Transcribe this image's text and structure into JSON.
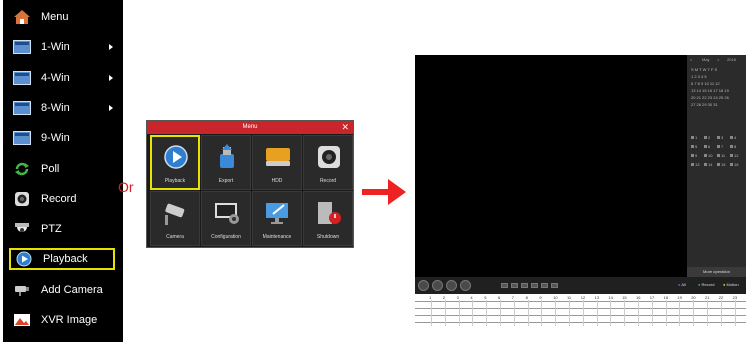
{
  "context_menu": {
    "items": [
      {
        "label": "Menu",
        "icon": "home-icon",
        "submenu": false
      },
      {
        "label": "1-Win",
        "icon": "window-icon",
        "submenu": true
      },
      {
        "label": "4-Win",
        "icon": "window-icon",
        "submenu": true
      },
      {
        "label": "8-Win",
        "icon": "window-icon",
        "submenu": true
      },
      {
        "label": "9-Win",
        "icon": "window-icon",
        "submenu": false
      },
      {
        "label": "Poll",
        "icon": "refresh-icon",
        "submenu": false
      },
      {
        "label": "Record",
        "icon": "record-icon",
        "submenu": false
      },
      {
        "label": "PTZ",
        "icon": "ptz-camera-icon",
        "submenu": false
      },
      {
        "label": "Playback",
        "icon": "playback-icon",
        "submenu": false,
        "selected": true
      },
      {
        "label": "Add Camera",
        "icon": "add-camera-icon",
        "submenu": false
      },
      {
        "label": "XVR Image",
        "icon": "image-icon",
        "submenu": false
      }
    ]
  },
  "or_text": "Or",
  "menu_dialog": {
    "title": "Menu",
    "close": "✕",
    "tiles": [
      {
        "label": "Playback",
        "icon": "playback-icon",
        "selected": true
      },
      {
        "label": "Export",
        "icon": "export-icon"
      },
      {
        "label": "HDD",
        "icon": "hdd-icon"
      },
      {
        "label": "Record",
        "icon": "record-icon"
      },
      {
        "label": "Camera",
        "icon": "camera-icon"
      },
      {
        "label": "Configuration",
        "icon": "configuration-icon"
      },
      {
        "label": "Maintenance",
        "icon": "maintenance-icon"
      },
      {
        "label": "Shutdown",
        "icon": "shutdown-icon"
      }
    ]
  },
  "playback": {
    "calendar": {
      "month": "May",
      "year": "2018",
      "weekdays": "S  M  T  W  T  F  S",
      "rows": [
        "      1   2   3   4   5",
        " 6   7   8   9  10  11  12",
        "13  14  15  16  17  18  19",
        "20  21  22  23  24  25  26",
        "27  28  29  30  31"
      ]
    },
    "channels": [
      [
        "1",
        "2",
        "3",
        "4"
      ],
      [
        "5",
        "6",
        "7",
        "8"
      ],
      [
        "9",
        "10",
        "11",
        "12"
      ],
      [
        "13",
        "14",
        "15",
        "16"
      ]
    ],
    "more_operation": "More operation",
    "filters": {
      "all": "All",
      "record": "Record",
      "motion": "Motion"
    },
    "timeline_hours": [
      "1",
      "2",
      "3",
      "4",
      "5",
      "6",
      "7",
      "8",
      "9",
      "10",
      "11",
      "12",
      "13",
      "14",
      "15",
      "16",
      "17",
      "18",
      "19",
      "20",
      "21",
      "22",
      "23"
    ]
  }
}
